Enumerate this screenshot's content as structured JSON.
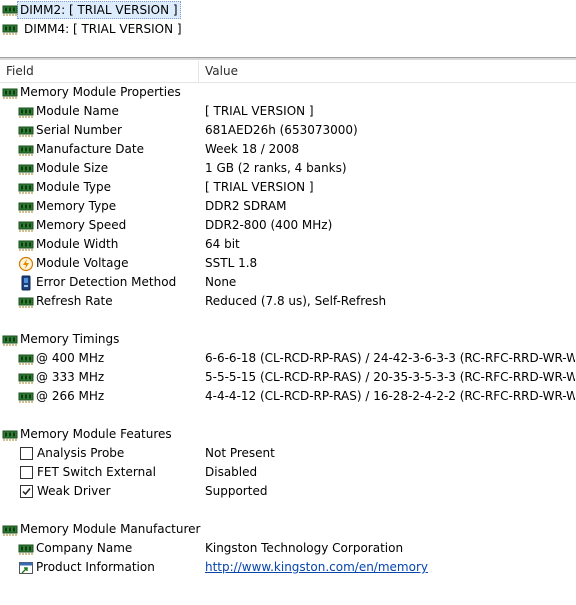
{
  "devices": [
    {
      "label": "DIMM2: [ TRIAL VERSION ]",
      "selected": true
    },
    {
      "label": "DIMM4: [ TRIAL VERSION ]",
      "selected": false
    }
  ],
  "columns": {
    "field": "Field",
    "value": "Value"
  },
  "groups": [
    {
      "title": "Memory Module Properties",
      "items": [
        {
          "field": "Module Name",
          "value": "[ TRIAL VERSION ]",
          "icon": "memory-chip-icon"
        },
        {
          "field": "Serial Number",
          "value": "681AED26h (653073000)",
          "icon": "memory-chip-icon"
        },
        {
          "field": "Manufacture Date",
          "value": "Week 18 / 2008",
          "icon": "memory-chip-icon"
        },
        {
          "field": "Module Size",
          "value": "1 GB (2 ranks, 4 banks)",
          "icon": "memory-chip-icon"
        },
        {
          "field": "Module Type",
          "value": "[ TRIAL VERSION ]",
          "icon": "memory-chip-icon"
        },
        {
          "field": "Memory Type",
          "value": "DDR2 SDRAM",
          "icon": "memory-chip-icon"
        },
        {
          "field": "Memory Speed",
          "value": "DDR2-800 (400 MHz)",
          "icon": "memory-chip-icon"
        },
        {
          "field": "Module Width",
          "value": "64 bit",
          "icon": "memory-chip-icon"
        },
        {
          "field": "Module Voltage",
          "value": "SSTL 1.8",
          "icon": "voltage-icon"
        },
        {
          "field": "Error Detection Method",
          "value": "None",
          "icon": "error-detection-icon"
        },
        {
          "field": "Refresh Rate",
          "value": "Reduced (7.8 us), Self-Refresh",
          "icon": "memory-chip-icon"
        }
      ]
    },
    {
      "title": "Memory Timings",
      "items": [
        {
          "field": "@ 400 MHz",
          "value": "6-6-6-18  (CL-RCD-RP-RAS) / 24-42-3-6-3-3  (RC-RFC-RRD-WR-W...",
          "icon": "memory-chip-icon"
        },
        {
          "field": "@ 333 MHz",
          "value": "5-5-5-15  (CL-RCD-RP-RAS) / 20-35-3-5-3-3  (RC-RFC-RRD-WR-W...",
          "icon": "memory-chip-icon"
        },
        {
          "field": "@ 266 MHz",
          "value": "4-4-4-12  (CL-RCD-RP-RAS) / 16-28-2-4-2-2  (RC-RFC-RRD-WR-W...",
          "icon": "memory-chip-icon"
        }
      ]
    },
    {
      "title": "Memory Module Features",
      "items": [
        {
          "field": "Analysis Probe",
          "value": "Not Present",
          "icon": "checkbox-unchecked",
          "checked": false
        },
        {
          "field": "FET Switch External",
          "value": "Disabled",
          "icon": "checkbox-unchecked",
          "checked": false
        },
        {
          "field": "Weak Driver",
          "value": "Supported",
          "icon": "checkbox-checked",
          "checked": true
        }
      ]
    },
    {
      "title": "Memory Module Manufacturer",
      "items": [
        {
          "field": "Company Name",
          "value": "Kingston Technology Corporation",
          "icon": "memory-chip-icon"
        },
        {
          "field": "Product Information",
          "value": "http://www.kingston.com/en/memory",
          "icon": "web-link-icon",
          "link": true
        }
      ]
    }
  ],
  "colors": {
    "chip_green": "#2f7d32",
    "chip_dark": "#1b4d1e",
    "link": "#0645ad",
    "selection": "#dcecfc"
  }
}
